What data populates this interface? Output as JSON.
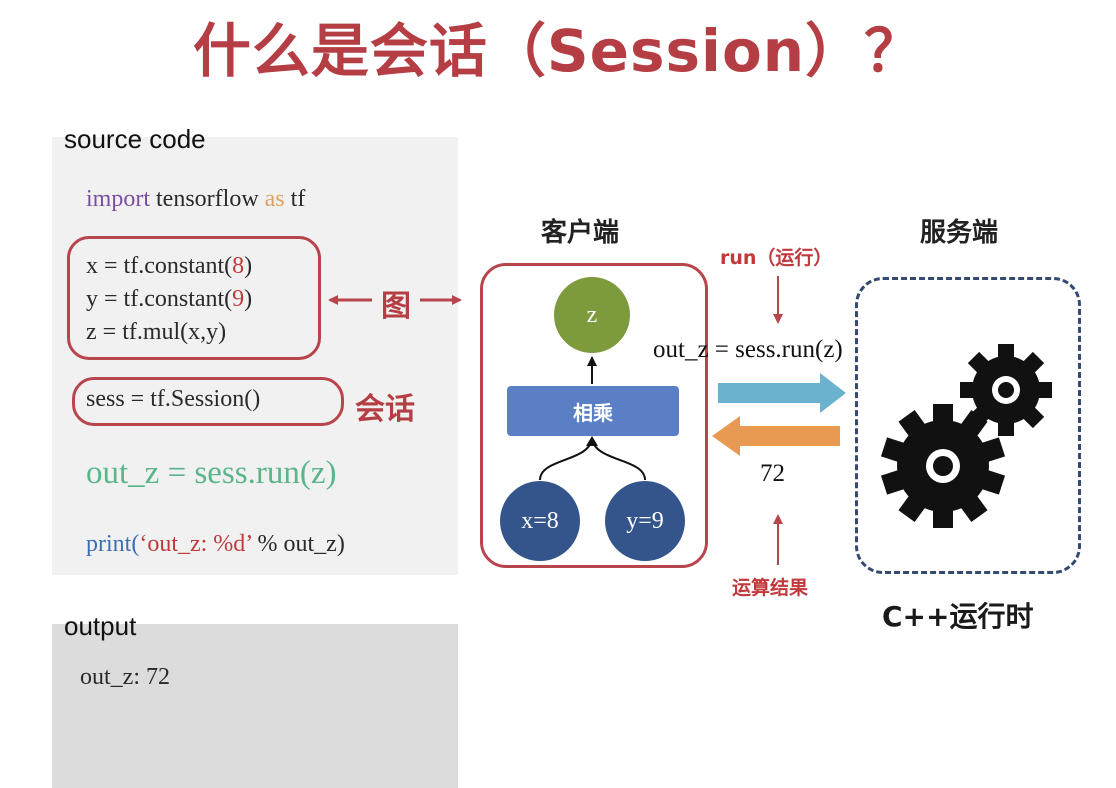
{
  "title": "什么是会话（Session）？",
  "source": {
    "label": "source code",
    "import_kw": "import",
    "import_mod": " tensorflow ",
    "import_as": "as",
    "import_alias": " tf",
    "x_pre": "x = tf.constant(",
    "x_num": "8",
    "y_pre": "y = tf.constant(",
    "y_num": "9",
    "close": ")",
    "z_line": "z = tf.mul(x,y)",
    "sess_line": "sess = tf.Session()",
    "run_line": "out_z = sess.run(z)",
    "print_kw": "print(",
    "print_str": "‘out_z: %d’",
    "print_rest": " % out_z)"
  },
  "labels": {
    "graph": "图",
    "session": "会话"
  },
  "output": {
    "label": "output",
    "value": "out_z: 72"
  },
  "client": {
    "title": "客户端",
    "node_z": "z",
    "op": "相乘",
    "node_x": "x=8",
    "node_y": "y=9"
  },
  "server": {
    "title": "服务端",
    "runtime": "C++运行时"
  },
  "flow": {
    "run_label": "run（运行）",
    "call": "out_z = sess.run(z)",
    "result_value": "72",
    "result_label": "运算结果"
  },
  "colors": {
    "accent_red": "#b53e44",
    "node_green": "#7d9a3c",
    "node_blue": "#34558b",
    "op_blue": "#5b7fc5",
    "arrow_teal": "#6bb2cf",
    "arrow_orange": "#e99a52"
  },
  "icons": [
    "gear-icon",
    "gear-icon"
  ]
}
